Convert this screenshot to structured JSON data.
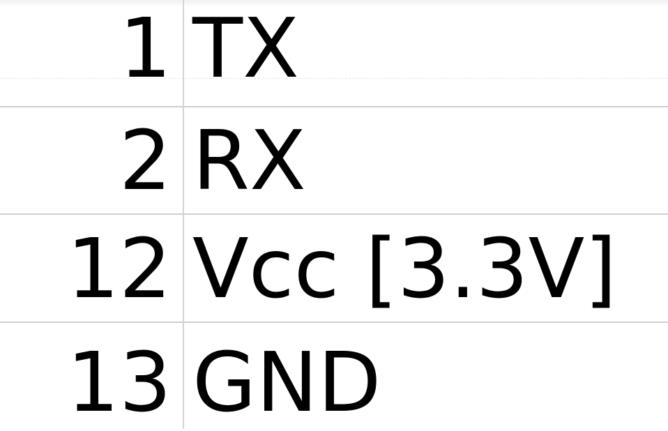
{
  "table": {
    "rows": [
      {
        "pin": "1",
        "signal": "TX"
      },
      {
        "pin": "2",
        "signal": "RX"
      },
      {
        "pin": "12",
        "signal": "Vcc [3.3V]"
      },
      {
        "pin": "13",
        "signal": "GND"
      }
    ]
  }
}
